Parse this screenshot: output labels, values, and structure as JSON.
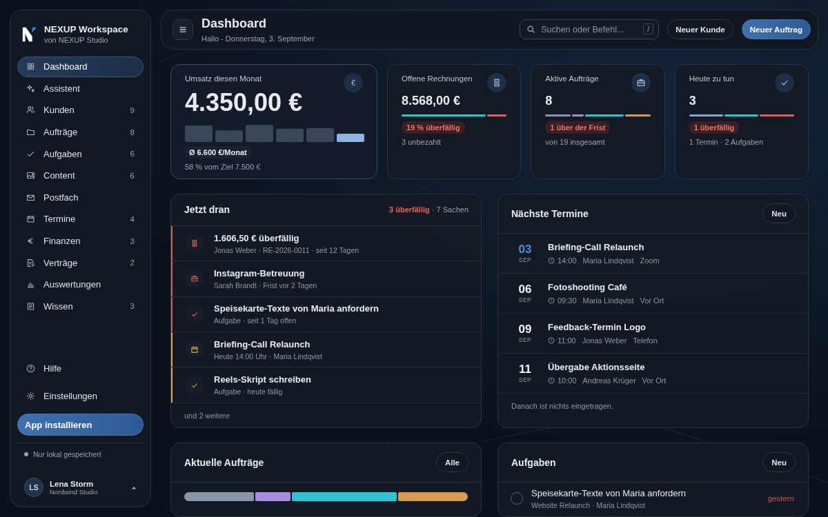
{
  "sidebar": {
    "brand": {
      "title": "NEXUP Workspace",
      "subtitle": "von NEXUP Studio"
    },
    "nav": [
      {
        "label": "Dashboard",
        "selected": true
      },
      {
        "label": "Assistent",
        "selected": false
      },
      {
        "label": "Kunden",
        "count": "9",
        "selected": false
      },
      {
        "label": "Aufträge",
        "count": "8",
        "selected": false
      },
      {
        "label": "Aufgaben",
        "count": "6",
        "selected": false
      },
      {
        "label": "Content",
        "count": "6",
        "selected": false
      },
      {
        "label": "Postfach",
        "selected": false
      },
      {
        "label": "Termine",
        "count": "4",
        "selected": false
      },
      {
        "label": "Finanzen",
        "count": "3",
        "selected": false
      },
      {
        "label": "Verträge",
        "count": "2",
        "selected": false
      },
      {
        "label": "Auswertungen",
        "selected": false
      },
      {
        "label": "Wissen",
        "count": "3",
        "selected": false
      }
    ],
    "footer_nav": [
      {
        "label": "Hilfe"
      },
      {
        "label": "Einstellungen"
      }
    ],
    "install_button": "App installieren",
    "storage_note": "Nur lokal gespeichert",
    "user": {
      "initials": "LS",
      "name": "Lena Storm",
      "org": "Nordwind Studio"
    }
  },
  "header": {
    "title": "Dashboard",
    "subtitle": "Hallo - Donnerstag, 3. September",
    "search": {
      "placeholder": "Suchen oder Befehl...",
      "shortcut": "/"
    },
    "buttons": [
      "Neuer Kunde",
      "Neuer Auftrag"
    ]
  },
  "revenue": {
    "label": "Umsatz diesen Monat",
    "icon": "€",
    "value": "4.350,00 €",
    "average": "Ø 6.600 €/Monat",
    "goal": "58 % vom Ziel 7.500 €"
  },
  "kpis": [
    {
      "label": "Offene Rechnungen",
      "value": "8.568,00 €",
      "badge": "19 % überfällig",
      "note": "3 unbezahlt",
      "segments": [
        {
          "color": "#2fc4d4"
        },
        {
          "color": "#e0605a"
        }
      ]
    },
    {
      "label": "Aktive Aufträge",
      "value": "8",
      "badge": "1 über der Frist",
      "note": "von 19 insgesamt",
      "segments": [
        {
          "color": "#8a95a8"
        },
        {
          "color": "#a98be0"
        },
        {
          "color": "#2fc4d4"
        },
        {
          "color": "#dc9a4c"
        }
      ]
    },
    {
      "label": "Heute zu tun",
      "value": "3",
      "badge": "1 überfällig",
      "note": "1 Termin · 2 Aufgaben",
      "segments": [
        {
          "color": "#7fa6d8"
        },
        {
          "color": "#2fc4d4"
        },
        {
          "color": "#e0605a"
        }
      ]
    }
  ],
  "now": {
    "title": "Jetzt dran",
    "overdue": "3 überfällig",
    "total": "· 7 Sachen",
    "items": [
      {
        "title": "1.606,50 € überfällig",
        "meta": "Jonas Weber · RE-2026-0011 · seit 12 Tagen",
        "color": "#e0605a"
      },
      {
        "title": "Instagram-Betreuung",
        "meta": "Sarah Brandt · Frist vor 2 Tagen",
        "color": "#e0605a"
      },
      {
        "title": "Speisekarte-Texte von Maria anfordern",
        "meta": "Aufgabe · seit 1 Tag offen",
        "color": "#e0605a"
      },
      {
        "title": "Briefing-Call Relaunch",
        "meta": "Heute 14:00 Uhr · Maria Lindqvist",
        "color": "#e0a84c"
      },
      {
        "title": "Reels-Skript schreiben",
        "meta": "Aufgabe · heute fällig",
        "color": "#e0a84c"
      }
    ],
    "more": "und 2 weitere"
  },
  "appointments": {
    "title": "Nächste Termine",
    "button": "Neu",
    "items": [
      {
        "day": "03",
        "month": "SEP",
        "today": true,
        "title": "Briefing-Call Relaunch",
        "time": "14:00",
        "person": "Maria Lindqvist",
        "place": "Zoom"
      },
      {
        "day": "06",
        "month": "SEP",
        "today": false,
        "title": "Fotoshooting Café",
        "time": "09:30",
        "person": "Maria Lindqvist",
        "place": "Vor Ort"
      },
      {
        "day": "09",
        "month": "SEP",
        "today": false,
        "title": "Feedback-Termin Logo",
        "time": "11:00",
        "person": "Jonas Weber",
        "place": "Telefon"
      },
      {
        "day": "11",
        "month": "SEP",
        "today": false,
        "title": "Übergabe Aktionsseite",
        "time": "10:00",
        "person": "Andreas Krüger",
        "place": "Vor Ort"
      }
    ],
    "empty_note": "Danach ist nichts eingetragen."
  },
  "orders": {
    "title": "Aktuelle Aufträge",
    "button": "Alle",
    "segments": [
      {
        "color": "#8a95a8"
      },
      {
        "color": "#a98be0"
      },
      {
        "color": "#2fc4d4"
      },
      {
        "color": "#dc9a4c"
      }
    ]
  },
  "tasks": {
    "title": "Aufgaben",
    "button": "Neu",
    "items": [
      {
        "title": "Speisekarte-Texte von Maria anfordern",
        "meta": "Website Relaunch · Maria Lindqvist",
        "due": "gestern",
        "checked": false
      }
    ]
  }
}
